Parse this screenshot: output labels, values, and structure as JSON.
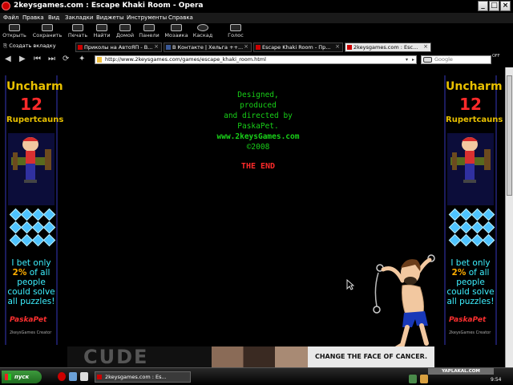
{
  "window": {
    "title": "2keysgames.com : Escape Khaki Room - Opera",
    "controls": [
      "_",
      "□",
      "×"
    ]
  },
  "menu": [
    "Файл",
    "Правка",
    "Вид",
    "Закладки",
    "Виджеты",
    "Инструменты",
    "Справка"
  ],
  "toolbar": {
    "buttons": [
      {
        "label": "Открыть",
        "icon": "open-icon"
      },
      {
        "label": "Сохранить",
        "icon": "save-icon"
      },
      {
        "label": "Печать",
        "icon": "print-icon"
      },
      {
        "label": "Найти",
        "icon": "find-icon"
      },
      {
        "label": "Домой",
        "icon": "home-icon"
      },
      {
        "label": "Панели",
        "icon": "panels-icon"
      },
      {
        "label": "Мозаика",
        "icon": "tile-icon"
      },
      {
        "label": "Каскад",
        "icon": "cascade-icon"
      },
      {
        "label": "Голос",
        "icon": "voice-icon"
      }
    ]
  },
  "tabs": {
    "new_tab_label": "Создать вкладку",
    "items": [
      {
        "label": "Приколы на АвтоЯП - В..."
      },
      {
        "label": "В Контакте | Хельга ++..."
      },
      {
        "label": "Escape Khaki Room - Пр..."
      },
      {
        "label": "2keysgames.com : Esc..."
      }
    ]
  },
  "address": {
    "url": "http://www.2keysgames.com/games/escape_khaki_room.html",
    "search_placeholder": "Google",
    "off_badge": "OFF"
  },
  "game": {
    "banner": {
      "title": "Uncharm",
      "number": "12",
      "subtitle": "Rupertcauns",
      "bet_pre": "I bet only",
      "bet_pct": "2%",
      "bet_post": "of all people could solve all puzzles!",
      "signature": "PaskaPet",
      "creator": "2keysGames Creator"
    },
    "credits": {
      "line1": "Designed,",
      "line2": "produced",
      "line3": "and directed by",
      "line4": "PaskaPet.",
      "site": "www.2keysGames.com",
      "year": "©2008"
    },
    "the_end": "THE END"
  },
  "ad": {
    "big_text": "CUDE",
    "cta": "CHANGE THE FACE OF CANCER."
  },
  "taskbar": {
    "start_label": "пуск",
    "task_label": "2keysgames.com : Es...",
    "watermark": "YAPLAKAL.COM",
    "clock": "9:54"
  },
  "colors": {
    "credits_green": "#18d018",
    "the_end_red": "#ff2a2a",
    "banner_yellow": "#e8c000",
    "banner_cyan": "#3df0ff"
  }
}
